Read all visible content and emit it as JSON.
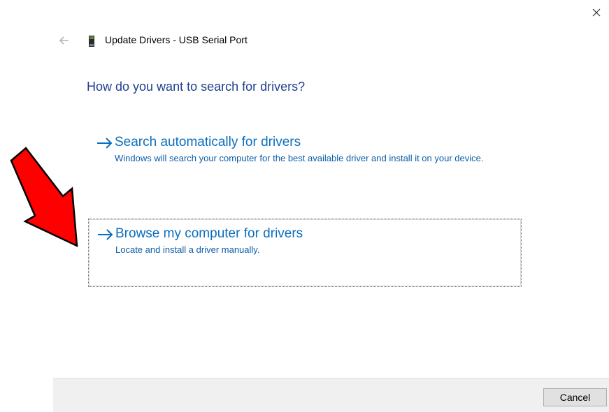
{
  "window": {
    "title": "Update Drivers - USB Serial Port"
  },
  "main": {
    "heading": "How do you want to search for drivers?",
    "options": [
      {
        "title": "Search automatically for drivers",
        "description": "Windows will search your computer for the best available driver and install it on your device."
      },
      {
        "title": "Browse my computer for drivers",
        "description": "Locate and install a driver manually."
      }
    ]
  },
  "footer": {
    "cancel_label": "Cancel"
  },
  "icons": {
    "close": "close-icon",
    "back": "back-arrow-icon",
    "device": "usb-device-icon",
    "option_arrow": "arrow-right-icon",
    "annotation": "red-arrow-icon"
  },
  "colors": {
    "heading": "#1f3f8f",
    "link": "#0b6fbd",
    "annotation_arrow": "#ff0000",
    "footer_bg": "#f0f0f0"
  }
}
